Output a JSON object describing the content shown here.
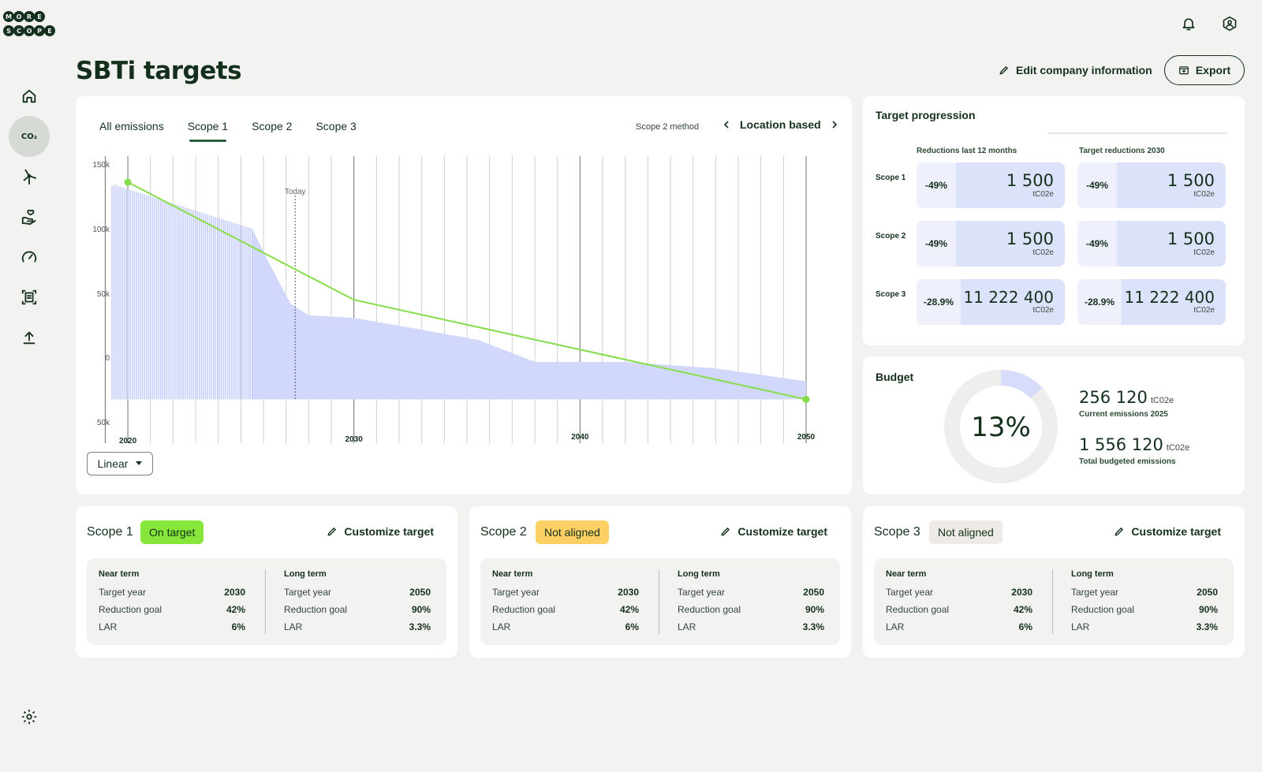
{
  "app": {
    "logo_letters": [
      "M",
      "O",
      "R",
      "E",
      "S",
      "C",
      "O",
      "P",
      "E"
    ]
  },
  "header": {
    "title": "SBTi targets",
    "edit_label": "Edit company information",
    "export_label": "Export"
  },
  "sidebar": {
    "items": [
      {
        "icon": "home-icon"
      },
      {
        "icon": "co2-icon",
        "label": "CO₂",
        "active": true
      },
      {
        "icon": "wind-turbine-icon"
      },
      {
        "icon": "hand-heart-icon"
      },
      {
        "icon": "speedometer-icon"
      },
      {
        "icon": "receipt-scan-icon"
      },
      {
        "icon": "upload-icon"
      }
    ],
    "settings_icon": "gear-icon"
  },
  "chart_card": {
    "tabs": [
      {
        "label": "All emissions",
        "active": false
      },
      {
        "label": "Scope 1",
        "active": true
      },
      {
        "label": "Scope 2",
        "active": false
      },
      {
        "label": "Scope 3",
        "active": false
      }
    ],
    "method_label": "Scope 2 method",
    "method_value": "Location based",
    "scale_select": "Linear"
  },
  "chart_data": {
    "type": "area",
    "y_ticks": [
      "150k",
      "100k",
      "50k",
      "0",
      "50k"
    ],
    "x_ticks": [
      {
        "label": "2020",
        "year": 2020
      },
      {
        "label": "2030",
        "year": 2030
      },
      {
        "label": "2040",
        "year": 2040
      },
      {
        "label": "2050",
        "year": 2050
      }
    ],
    "today_label": "Today",
    "today_year": 2027.4,
    "ylim": [
      -50000,
      150000
    ],
    "xlim": [
      2019.3,
      2050
    ],
    "colors": {
      "area": "#d2d8fb",
      "bars": "#c7cef9",
      "target": "#86dd4a",
      "grid": "#cfcfcf"
    },
    "history_bars_y": [
      133000,
      133500,
      134000,
      133000,
      132500,
      132000,
      131500,
      131000,
      130500,
      130000,
      129500,
      129000,
      128500,
      128000,
      127500,
      127000,
      126500,
      126000,
      125500,
      125000,
      124500,
      124000,
      123500,
      123000,
      122500,
      122000,
      121500,
      121000,
      120500,
      120000,
      119500,
      119000,
      118500,
      118000,
      117500,
      117000,
      116500,
      116000,
      115500,
      115000,
      114500,
      114000,
      113500,
      113000,
      112500,
      112000,
      111500,
      111000,
      110500,
      110000,
      109500,
      109000,
      108500,
      108000,
      107500,
      107000,
      106500,
      106000,
      105500,
      105000,
      104500,
      104000,
      103500,
      103000,
      102500,
      102000,
      101500,
      101000,
      100500,
      100000
    ],
    "history_bar_x_range": [
      2019.3,
      2025.5
    ],
    "forecast_area": [
      {
        "x": 2025.5,
        "y": 100000
      },
      {
        "x": 2026.2,
        "y": 75000
      },
      {
        "x": 2027.2,
        "y": 42000
      },
      {
        "x": 2028.0,
        "y": 33000
      },
      {
        "x": 2030.0,
        "y": 31000
      },
      {
        "x": 2032.0,
        "y": 25000
      },
      {
        "x": 2035.5,
        "y": 14000
      },
      {
        "x": 2038.0,
        "y": -3000
      },
      {
        "x": 2042.0,
        "y": -3000
      },
      {
        "x": 2046.0,
        "y": -8000
      },
      {
        "x": 2050.0,
        "y": -18000
      }
    ],
    "target_line": [
      {
        "x": 2020.0,
        "y": 136000
      },
      {
        "x": 2030.0,
        "y": 45000
      },
      {
        "x": 2050.0,
        "y": -32000
      }
    ]
  },
  "target_progression": {
    "title": "Target progression",
    "col1": "Reductions last 12 months",
    "col2": "Target reductions 2030",
    "rows": [
      {
        "label": "Scope 1",
        "a_pct": "-49%",
        "a_val": "1 500",
        "b_pct": "-49%",
        "b_val": "1 500",
        "unit": "tC02e"
      },
      {
        "label": "Scope 2",
        "a_pct": "-49%",
        "a_val": "1 500",
        "b_pct": "-49%",
        "b_val": "1 500",
        "unit": "tC02e"
      },
      {
        "label": "Scope 3",
        "a_pct": "-28.9%",
        "a_val": "11 222 400",
        "b_pct": "-28.9%",
        "b_val": "11 222 400",
        "unit": "tC02e"
      }
    ]
  },
  "budget": {
    "title": "Budget",
    "percent_label": "13%",
    "percent_value": 0.13,
    "current_value": "256 120",
    "current_unit": "tC02e",
    "current_label": "Current emissions 2025",
    "total_value": "1 556 120",
    "total_unit": "tC02e",
    "total_label": "Total budgeted emissions",
    "colors": {
      "fill": "#d7dcfb",
      "track": "#f0eeec"
    }
  },
  "scopes": [
    {
      "title": "Scope 1",
      "status": "On target",
      "status_color": "#86e63a",
      "customize": "Customize target",
      "near": {
        "h": "Near term",
        "target_year_l": "Target year",
        "target_year": "2030",
        "goal_l": "Reduction goal",
        "goal": "42%",
        "lar_l": "LAR",
        "lar": "6%"
      },
      "long": {
        "h": "Long term",
        "target_year_l": "Target year",
        "target_year": "2050",
        "goal_l": "Reduction goal",
        "goal": "90%",
        "lar_l": "LAR",
        "lar": "3.3%"
      }
    },
    {
      "title": "Scope 2",
      "status": "Not aligned",
      "status_color": "#fdd066",
      "customize": "Customize target",
      "near": {
        "h": "Near term",
        "target_year_l": "Target year",
        "target_year": "2030",
        "goal_l": "Reduction goal",
        "goal": "42%",
        "lar_l": "LAR",
        "lar": "6%"
      },
      "long": {
        "h": "Long term",
        "target_year_l": "Target year",
        "target_year": "2050",
        "goal_l": "Reduction goal",
        "goal": "90%",
        "lar_l": "LAR",
        "lar": "3.3%"
      }
    },
    {
      "title": "Scope 3",
      "status": "Not aligned",
      "status_color": "#eeeae6",
      "customize": "Customize target",
      "near": {
        "h": "Near term",
        "target_year_l": "Target year",
        "target_year": "2030",
        "goal_l": "Reduction goal",
        "goal": "42%",
        "lar_l": "LAR",
        "lar": "6%"
      },
      "long": {
        "h": "Long term",
        "target_year_l": "Target year",
        "target_year": "2050",
        "goal_l": "Reduction goal",
        "goal": "90%",
        "lar_l": "LAR",
        "lar": "3.3%"
      }
    }
  ]
}
